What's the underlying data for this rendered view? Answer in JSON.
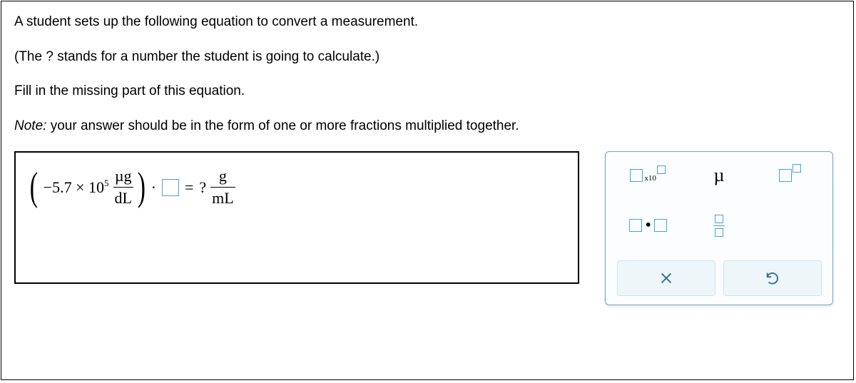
{
  "prompt": {
    "line1": "A student sets up the following equation to convert a measurement.",
    "line2": "(The ? stands for a number the student is going to calculate.)",
    "line3": "Fill in the missing part of this equation.",
    "note_prefix": "Note:",
    "note_rest": " your answer should be in the form of one or more fractions multiplied together."
  },
  "equation": {
    "coefficient": "−5.7",
    "times": "×",
    "base": "10",
    "exponent": "5",
    "given_unit_num": "µg",
    "given_unit_den": "dL",
    "dot": "·",
    "equals": "=",
    "question": "?",
    "result_unit_num": "g",
    "result_unit_den": "mL"
  },
  "toolbar": {
    "sci_label": "x10",
    "mu_label": "µ",
    "multiply_dot": "•",
    "clear_label": "×",
    "reset_label": "↺"
  }
}
